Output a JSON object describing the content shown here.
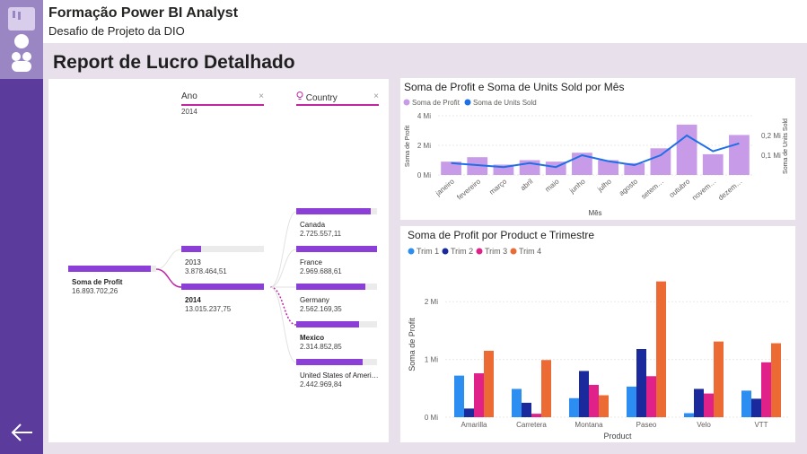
{
  "app": {
    "title": "Formação Power BI Analyst",
    "subtitle": "Desafio de Projeto da DIO"
  },
  "colors": {
    "rail": "#5b3c9d",
    "canvas": "#e8e1ec",
    "tree_bar": "#8b3fd6",
    "accent_line": "#c026a4",
    "profit_bar": "#c79be8",
    "units_line": "#1f6fe6",
    "trim1": "#2c8ef0",
    "trim2": "#1a2a9c",
    "trim3": "#e0218a",
    "trim4": "#ec6b35"
  },
  "icons": {
    "back": "arrow-left-icon",
    "filter_hint": "lightbulb-icon",
    "close": "close-icon"
  },
  "report": {
    "title": "Report de Lucro Detalhado"
  },
  "tree": {
    "levels": [
      {
        "name": "Ano",
        "filter": "2014",
        "close": "×"
      },
      {
        "name": "Country",
        "filter": "",
        "close": "×"
      }
    ],
    "root": {
      "label": "Soma de Profit",
      "value": "16.893.702,26",
      "share": 1.0
    },
    "years": [
      {
        "label": "2013",
        "value": "3.878.464,51",
        "share": 0.24
      },
      {
        "label": "2014",
        "value": "13.015.237,75",
        "share": 1.0,
        "selected": true
      }
    ],
    "countries": [
      {
        "label": "Canada",
        "value": "2.725.557,11",
        "share": 0.92
      },
      {
        "label": "France",
        "value": "2.969.688,61",
        "share": 1.0
      },
      {
        "label": "Germany",
        "value": "2.562.169,35",
        "share": 0.86
      },
      {
        "label": "Mexico",
        "value": "2.314.852,85",
        "share": 0.78,
        "selected": true
      },
      {
        "label": "United States of Ameri…",
        "value": "2.442.969,84",
        "share": 0.82
      }
    ]
  },
  "chart_data": [
    {
      "type": "bar",
      "title": "Soma de Profit e Soma de Units Sold por Mês",
      "xlabel": "Mês",
      "ylabel": "Soma de Profit",
      "y2label": "Soma de Units Sold",
      "legend": [
        "Soma de Profit",
        "Soma de Units Sold"
      ],
      "categories": [
        "janeiro",
        "fevereiro",
        "março",
        "abril",
        "maio",
        "junho",
        "julho",
        "agosto",
        "setem…",
        "outubro",
        "novem…",
        "dezem…"
      ],
      "series": [
        {
          "name": "Soma de Profit",
          "kind": "bar",
          "axis": "left",
          "values": [
            0.9,
            1.2,
            0.7,
            1.0,
            0.9,
            1.5,
            1.0,
            0.8,
            1.8,
            3.4,
            1.4,
            2.7
          ]
        },
        {
          "name": "Soma de Units Sold",
          "kind": "line",
          "axis": "right",
          "values": [
            0.06,
            0.05,
            0.04,
            0.06,
            0.04,
            0.1,
            0.07,
            0.05,
            0.1,
            0.2,
            0.12,
            0.16
          ]
        }
      ],
      "ylim": [
        0,
        4
      ],
      "y2lim": [
        0,
        0.3
      ],
      "yticks": [
        "0 Mi",
        "2 Mi",
        "4 Mi"
      ],
      "y2ticks": [
        "0,1 Mi",
        "0,2 Mi"
      ],
      "legend_position": "top-left"
    },
    {
      "type": "bar",
      "title": "Soma de Profit por Product e Trimestre",
      "xlabel": "Product",
      "ylabel": "Soma de Profit",
      "categories": [
        "Amarilla",
        "Carretera",
        "Montana",
        "Paseo",
        "Velo",
        "VTT"
      ],
      "series": [
        {
          "name": "Trim 1",
          "values": [
            0.72,
            0.49,
            0.33,
            0.53,
            0.07,
            0.46
          ]
        },
        {
          "name": "Trim 2",
          "values": [
            0.15,
            0.25,
            0.8,
            1.18,
            0.49,
            0.32
          ]
        },
        {
          "name": "Trim 3",
          "values": [
            0.76,
            0.06,
            0.56,
            0.71,
            0.41,
            0.95
          ]
        },
        {
          "name": "Trim 4",
          "values": [
            1.15,
            0.99,
            0.38,
            2.35,
            1.31,
            1.28
          ]
        }
      ],
      "ylim": [
        0,
        2.5
      ],
      "yticks": [
        "0 Mi",
        "1 Mi",
        "2 Mi"
      ],
      "legend_position": "top-left"
    }
  ]
}
